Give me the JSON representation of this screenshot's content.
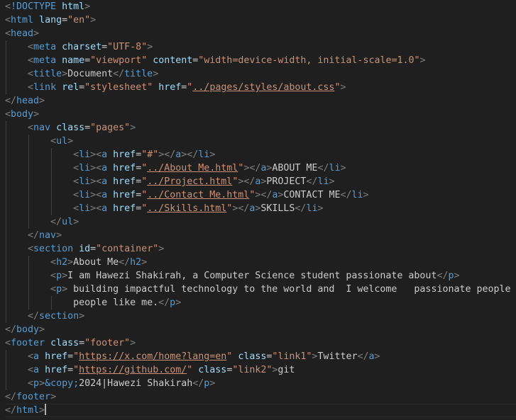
{
  "editor": {
    "language": "html",
    "colors": {
      "background": "#1f1f1f",
      "bracket": "#808080",
      "tag": "#569cd6",
      "attribute": "#9cdcfe",
      "string": "#ce9178",
      "text": "#cccccc"
    },
    "lines": [
      [
        [
          "b",
          "<"
        ],
        [
          "t",
          "!DOCTYPE"
        ],
        [
          "x",
          " "
        ],
        [
          "a",
          "html"
        ],
        [
          "b",
          ">"
        ]
      ],
      [
        [
          "b",
          "<"
        ],
        [
          "t",
          "html"
        ],
        [
          "x",
          " "
        ],
        [
          "a",
          "lang"
        ],
        [
          "e",
          "="
        ],
        [
          "s",
          "\"en\""
        ],
        [
          "b",
          ">"
        ]
      ],
      [
        [
          "b",
          "<"
        ],
        [
          "t",
          "head"
        ],
        [
          "b",
          ">"
        ]
      ],
      [
        [
          "x",
          "    "
        ],
        [
          "b",
          "<"
        ],
        [
          "t",
          "meta"
        ],
        [
          "x",
          " "
        ],
        [
          "a",
          "charset"
        ],
        [
          "e",
          "="
        ],
        [
          "s",
          "\"UTF-8\""
        ],
        [
          "b",
          ">"
        ]
      ],
      [
        [
          "x",
          "    "
        ],
        [
          "b",
          "<"
        ],
        [
          "t",
          "meta"
        ],
        [
          "x",
          " "
        ],
        [
          "a",
          "name"
        ],
        [
          "e",
          "="
        ],
        [
          "s",
          "\"viewport\""
        ],
        [
          "x",
          " "
        ],
        [
          "a",
          "content"
        ],
        [
          "e",
          "="
        ],
        [
          "s",
          "\"width=device-width, initial-scale=1.0\""
        ],
        [
          "b",
          ">"
        ]
      ],
      [
        [
          "x",
          "    "
        ],
        [
          "b",
          "<"
        ],
        [
          "t",
          "title"
        ],
        [
          "b",
          ">"
        ],
        [
          "x",
          "Document"
        ],
        [
          "b",
          "</"
        ],
        [
          "t",
          "title"
        ],
        [
          "b",
          ">"
        ]
      ],
      [
        [
          "x",
          "    "
        ],
        [
          "b",
          "<"
        ],
        [
          "t",
          "link"
        ],
        [
          "x",
          " "
        ],
        [
          "a",
          "rel"
        ],
        [
          "e",
          "="
        ],
        [
          "s",
          "\"stylesheet\""
        ],
        [
          "x",
          " "
        ],
        [
          "a",
          "href"
        ],
        [
          "e",
          "="
        ],
        [
          "s",
          "\""
        ],
        [
          "l",
          "../pages/styles/about.css"
        ],
        [
          "s",
          "\""
        ],
        [
          "b",
          ">"
        ]
      ],
      [
        [
          "b",
          "</"
        ],
        [
          "t",
          "head"
        ],
        [
          "b",
          ">"
        ]
      ],
      [
        [
          "b",
          "<"
        ],
        [
          "t",
          "body"
        ],
        [
          "b",
          ">"
        ]
      ],
      [
        [
          "x",
          "    "
        ],
        [
          "b",
          "<"
        ],
        [
          "t",
          "nav"
        ],
        [
          "x",
          " "
        ],
        [
          "a",
          "class"
        ],
        [
          "e",
          "="
        ],
        [
          "s",
          "\"pages\""
        ],
        [
          "b",
          ">"
        ]
      ],
      [
        [
          "x",
          "        "
        ],
        [
          "b",
          "<"
        ],
        [
          "t",
          "ul"
        ],
        [
          "b",
          ">"
        ]
      ],
      [
        [
          "x",
          "            "
        ],
        [
          "b",
          "<"
        ],
        [
          "t",
          "li"
        ],
        [
          "b",
          "><"
        ],
        [
          "t",
          "a"
        ],
        [
          "x",
          " "
        ],
        [
          "a",
          "href"
        ],
        [
          "e",
          "="
        ],
        [
          "s",
          "\"#\""
        ],
        [
          "b",
          "></"
        ],
        [
          "t",
          "a"
        ],
        [
          "b",
          "></"
        ],
        [
          "t",
          "li"
        ],
        [
          "b",
          ">"
        ]
      ],
      [
        [
          "x",
          "            "
        ],
        [
          "b",
          "<"
        ],
        [
          "t",
          "li"
        ],
        [
          "b",
          "><"
        ],
        [
          "t",
          "a"
        ],
        [
          "x",
          " "
        ],
        [
          "a",
          "href"
        ],
        [
          "e",
          "="
        ],
        [
          "s",
          "\""
        ],
        [
          "l",
          "../About Me.html"
        ],
        [
          "s",
          "\""
        ],
        [
          "b",
          "></"
        ],
        [
          "t",
          "a"
        ],
        [
          "b",
          ">"
        ],
        [
          "x",
          "ABOUT ME"
        ],
        [
          "b",
          "</"
        ],
        [
          "t",
          "li"
        ],
        [
          "b",
          ">"
        ]
      ],
      [
        [
          "x",
          "            "
        ],
        [
          "b",
          "<"
        ],
        [
          "t",
          "li"
        ],
        [
          "b",
          "><"
        ],
        [
          "t",
          "a"
        ],
        [
          "x",
          " "
        ],
        [
          "a",
          "href"
        ],
        [
          "e",
          "="
        ],
        [
          "s",
          "\""
        ],
        [
          "l",
          "../Project.html"
        ],
        [
          "s",
          "\""
        ],
        [
          "b",
          "></"
        ],
        [
          "t",
          "a"
        ],
        [
          "b",
          ">"
        ],
        [
          "x",
          "PROJECT"
        ],
        [
          "b",
          "</"
        ],
        [
          "t",
          "li"
        ],
        [
          "b",
          ">"
        ]
      ],
      [
        [
          "x",
          "            "
        ],
        [
          "b",
          "<"
        ],
        [
          "t",
          "li"
        ],
        [
          "b",
          "><"
        ],
        [
          "t",
          "a"
        ],
        [
          "x",
          " "
        ],
        [
          "a",
          "href"
        ],
        [
          "e",
          "="
        ],
        [
          "s",
          "\""
        ],
        [
          "l",
          "../Contact Me.html"
        ],
        [
          "s",
          "\""
        ],
        [
          "b",
          "></"
        ],
        [
          "t",
          "a"
        ],
        [
          "b",
          ">"
        ],
        [
          "x",
          "CONTACT ME"
        ],
        [
          "b",
          "</"
        ],
        [
          "t",
          "li"
        ],
        [
          "b",
          ">"
        ]
      ],
      [
        [
          "x",
          "            "
        ],
        [
          "b",
          "<"
        ],
        [
          "t",
          "li"
        ],
        [
          "b",
          "><"
        ],
        [
          "t",
          "a"
        ],
        [
          "x",
          " "
        ],
        [
          "a",
          "href"
        ],
        [
          "e",
          "="
        ],
        [
          "s",
          "\""
        ],
        [
          "l",
          "../Skills.html"
        ],
        [
          "s",
          "\""
        ],
        [
          "b",
          "></"
        ],
        [
          "t",
          "a"
        ],
        [
          "b",
          ">"
        ],
        [
          "x",
          "SKILLS"
        ],
        [
          "b",
          "</"
        ],
        [
          "t",
          "li"
        ],
        [
          "b",
          ">"
        ]
      ],
      [
        [
          "x",
          "        "
        ],
        [
          "b",
          "</"
        ],
        [
          "t",
          "ul"
        ],
        [
          "b",
          ">"
        ]
      ],
      [
        [
          "x",
          "    "
        ],
        [
          "b",
          "</"
        ],
        [
          "t",
          "nav"
        ],
        [
          "b",
          ">"
        ]
      ],
      [
        [
          "x",
          "    "
        ],
        [
          "b",
          "<"
        ],
        [
          "t",
          "section"
        ],
        [
          "x",
          " "
        ],
        [
          "a",
          "id"
        ],
        [
          "e",
          "="
        ],
        [
          "s",
          "\"container\""
        ],
        [
          "b",
          ">"
        ]
      ],
      [
        [
          "x",
          "        "
        ],
        [
          "b",
          "<"
        ],
        [
          "t",
          "h2"
        ],
        [
          "b",
          ">"
        ],
        [
          "x",
          "About Me"
        ],
        [
          "b",
          "</"
        ],
        [
          "t",
          "h2"
        ],
        [
          "b",
          ">"
        ]
      ],
      [
        [
          "x",
          "        "
        ],
        [
          "b",
          "<"
        ],
        [
          "t",
          "p"
        ],
        [
          "b",
          ">"
        ],
        [
          "x",
          "I am Hawezi Shakirah, a Computer Science student passionate about"
        ],
        [
          "b",
          "</"
        ],
        [
          "t",
          "p"
        ],
        [
          "b",
          ">"
        ]
      ],
      [
        [
          "x",
          "        "
        ],
        [
          "b",
          "<"
        ],
        [
          "t",
          "p"
        ],
        [
          "b",
          ">"
        ],
        [
          "x",
          " building impactful technology to the world and  I welcome   passionate people"
        ]
      ],
      [
        [
          "x",
          "            people like me."
        ],
        [
          "b",
          "</"
        ],
        [
          "t",
          "p"
        ],
        [
          "b",
          ">"
        ]
      ],
      [
        [
          "x",
          "    "
        ],
        [
          "b",
          "</"
        ],
        [
          "t",
          "section"
        ],
        [
          "b",
          ">"
        ]
      ],
      [
        [
          "b",
          "</"
        ],
        [
          "t",
          "body"
        ],
        [
          "b",
          ">"
        ]
      ],
      [
        [
          "b",
          "<"
        ],
        [
          "t",
          "footer"
        ],
        [
          "x",
          " "
        ],
        [
          "a",
          "class"
        ],
        [
          "e",
          "="
        ],
        [
          "s",
          "\"footer\""
        ],
        [
          "b",
          ">"
        ]
      ],
      [
        [
          "x",
          "    "
        ],
        [
          "b",
          "<"
        ],
        [
          "t",
          "a"
        ],
        [
          "x",
          " "
        ],
        [
          "a",
          "href"
        ],
        [
          "e",
          "="
        ],
        [
          "s",
          "\""
        ],
        [
          "l",
          "https://x.com/home?lang=en"
        ],
        [
          "s",
          "\""
        ],
        [
          "x",
          " "
        ],
        [
          "a",
          "class"
        ],
        [
          "e",
          "="
        ],
        [
          "s",
          "\"link1\""
        ],
        [
          "b",
          ">"
        ],
        [
          "x",
          "Twitter"
        ],
        [
          "b",
          "</"
        ],
        [
          "t",
          "a"
        ],
        [
          "b",
          ">"
        ]
      ],
      [
        [
          "x",
          "    "
        ],
        [
          "b",
          "<"
        ],
        [
          "t",
          "a"
        ],
        [
          "x",
          " "
        ],
        [
          "a",
          "href"
        ],
        [
          "e",
          "="
        ],
        [
          "s",
          "\""
        ],
        [
          "l",
          "https://github.com/"
        ],
        [
          "s",
          "\""
        ],
        [
          "x",
          " "
        ],
        [
          "a",
          "class"
        ],
        [
          "e",
          "="
        ],
        [
          "s",
          "\"link2\""
        ],
        [
          "b",
          ">"
        ],
        [
          "x",
          "git"
        ]
      ],
      [
        [
          "x",
          "    "
        ],
        [
          "b",
          "<"
        ],
        [
          "t",
          "p"
        ],
        [
          "b",
          ">"
        ],
        [
          "n",
          "&copy;"
        ],
        [
          "x",
          "2024|Hawezi Shakirah"
        ],
        [
          "b",
          "</"
        ],
        [
          "t",
          "p"
        ],
        [
          "b",
          ">"
        ]
      ],
      [
        [
          "b",
          "</"
        ],
        [
          "t",
          "footer"
        ],
        [
          "b",
          ">"
        ]
      ],
      [
        [
          "b",
          "</"
        ],
        [
          "t",
          "html"
        ],
        [
          "b",
          ">"
        ]
      ]
    ],
    "cursor_line": 31
  }
}
